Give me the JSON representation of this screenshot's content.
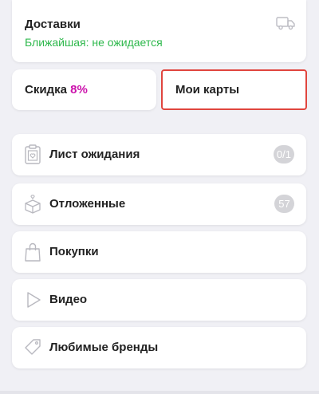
{
  "deliveries": {
    "title": "Доставки",
    "subtitle": "Ближайшая: не ожидается",
    "icon": "truck-icon"
  },
  "discount": {
    "label": "Скидка",
    "value": "8%"
  },
  "my_cards": {
    "label": "Мои карты"
  },
  "menu": [
    {
      "label": "Лист ожидания",
      "icon": "clipboard-heart-icon",
      "badge": "0/1"
    },
    {
      "label": "Отложенные",
      "icon": "gift-box-icon",
      "badge": "57"
    },
    {
      "label": "Покупки",
      "icon": "shopping-bag-icon",
      "badge": ""
    },
    {
      "label": "Видео",
      "icon": "play-icon",
      "badge": ""
    },
    {
      "label": "Любимые бренды",
      "icon": "tag-icon",
      "badge": ""
    }
  ],
  "colors": {
    "accent_green": "#2eb84c",
    "accent_magenta": "#cb11ab",
    "highlight_red": "#e0453e",
    "badge_gray": "#d4d4d8"
  }
}
